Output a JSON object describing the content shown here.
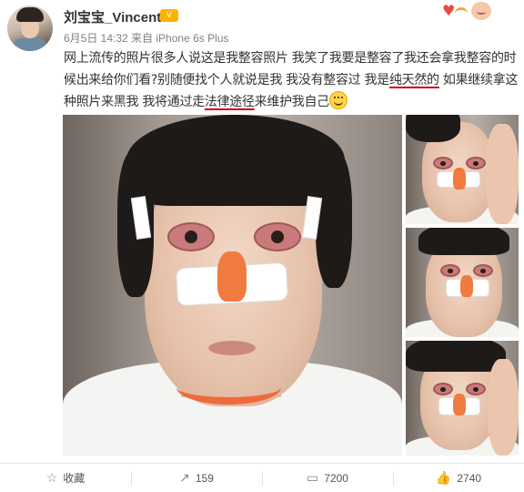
{
  "header": {
    "username": "刘宝宝_Vincent",
    "vip_label": "V",
    "meta": "6月5日 14:32 来自 iPhone 6s Plus"
  },
  "post": {
    "part1": "网上流传的照片很多人说这是我整容照片 我笑了我要是整容了我还会拿我整容的时候出来给你们看?别随便找个人就说是我 我没有整容过 我是",
    "underline1": "纯天然的",
    "part2": " 如果继续拿这种照片来黑我 我将通过走",
    "underline2": "法律途径",
    "part3": "来维护我自己",
    "underline_color": "#d0021b"
  },
  "actions": {
    "favorite": "收藏",
    "repost": "159",
    "comment": "7200",
    "like": "2740"
  },
  "icons": [
    "star-icon",
    "repost-icon",
    "comment-icon",
    "like-icon",
    "smile-icon",
    "heart-icon"
  ]
}
